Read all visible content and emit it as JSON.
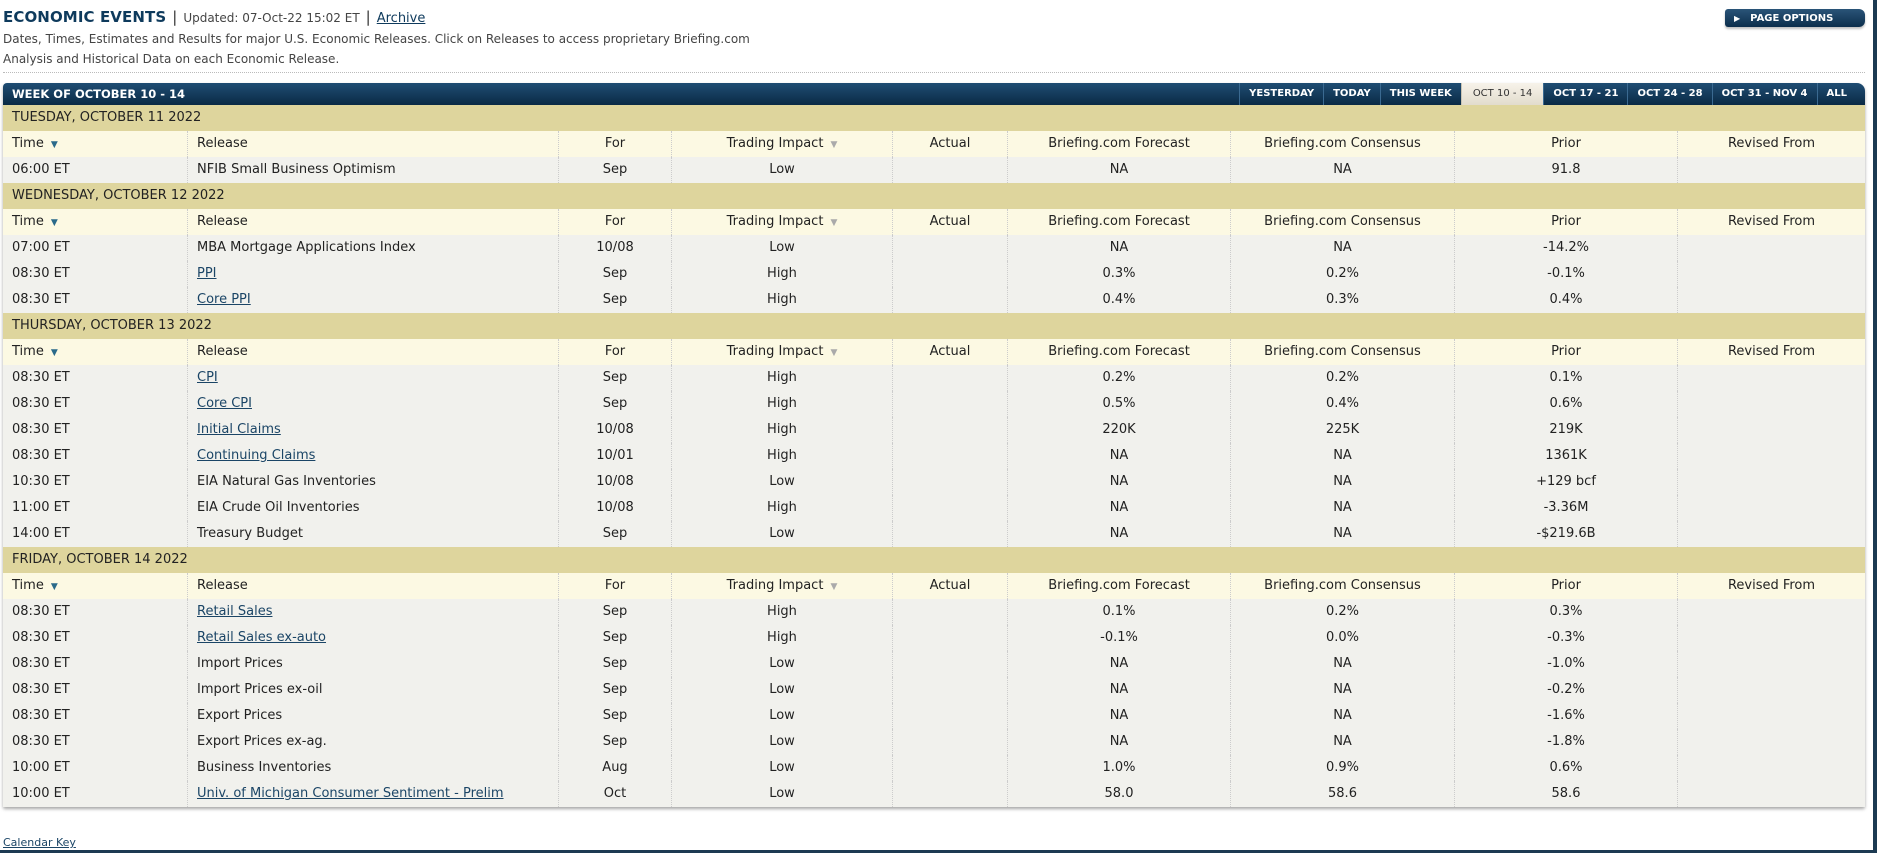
{
  "header": {
    "title": "ECONOMIC EVENTS",
    "separator": "|",
    "updated": "Updated: 07-Oct-22 15:02 ET",
    "archive_label": "Archive",
    "description": "Dates, Times, Estimates and Results for major U.S. Economic Releases. Click on Releases to access proprietary Briefing.com Analysis and Historical Data on each Economic Release."
  },
  "page_options": {
    "label": "PAGE OPTIONS",
    "icon": "play-triangle-icon"
  },
  "week_bar": {
    "title": "WEEK OF OCTOBER 10 - 14",
    "tabs": [
      {
        "label": "YESTERDAY",
        "active": false
      },
      {
        "label": "TODAY",
        "active": false
      },
      {
        "label": "THIS WEEK",
        "active": false
      },
      {
        "label": "OCT 10 - 14",
        "active": true
      },
      {
        "label": "OCT 17 - 21",
        "active": false
      },
      {
        "label": "OCT 24 - 28",
        "active": false
      },
      {
        "label": "OCT 31 - NOV 4",
        "active": false
      },
      {
        "label": "ALL",
        "active": false
      }
    ]
  },
  "columns": {
    "time": "Time",
    "release": "Release",
    "for": "For",
    "impact": "Trading Impact",
    "actual": "Actual",
    "forecast": "Briefing.com Forecast",
    "consensus": "Briefing.com Consensus",
    "prior": "Prior",
    "revised": "Revised From"
  },
  "days": [
    {
      "label": "TUESDAY, OCTOBER 11 2022",
      "rows": [
        {
          "time": "06:00 ET",
          "release": "NFIB Small Business Optimism",
          "link": false,
          "for": "Sep",
          "impact": "Low",
          "actual": "",
          "forecast": "NA",
          "consensus": "NA",
          "prior": "91.8",
          "revised": ""
        }
      ]
    },
    {
      "label": "WEDNESDAY, OCTOBER 12 2022",
      "rows": [
        {
          "time": "07:00 ET",
          "release": "MBA Mortgage Applications Index",
          "link": false,
          "for": "10/08",
          "impact": "Low",
          "actual": "",
          "forecast": "NA",
          "consensus": "NA",
          "prior": "-14.2%",
          "revised": ""
        },
        {
          "time": "08:30 ET",
          "release": "PPI",
          "link": true,
          "for": "Sep",
          "impact": "High",
          "actual": "",
          "forecast": "0.3%",
          "consensus": "0.2%",
          "prior": "-0.1%",
          "revised": ""
        },
        {
          "time": "08:30 ET",
          "release": "Core PPI",
          "link": true,
          "for": "Sep",
          "impact": "High",
          "actual": "",
          "forecast": "0.4%",
          "consensus": "0.3%",
          "prior": "0.4%",
          "revised": ""
        }
      ]
    },
    {
      "label": "THURSDAY, OCTOBER 13 2022",
      "rows": [
        {
          "time": "08:30 ET",
          "release": "CPI",
          "link": true,
          "for": "Sep",
          "impact": "High",
          "actual": "",
          "forecast": "0.2%",
          "consensus": "0.2%",
          "prior": "0.1%",
          "revised": ""
        },
        {
          "time": "08:30 ET",
          "release": "Core CPI",
          "link": true,
          "for": "Sep",
          "impact": "High",
          "actual": "",
          "forecast": "0.5%",
          "consensus": "0.4%",
          "prior": "0.6%",
          "revised": ""
        },
        {
          "time": "08:30 ET",
          "release": "Initial Claims",
          "link": true,
          "for": "10/08",
          "impact": "High",
          "actual": "",
          "forecast": "220K",
          "consensus": "225K",
          "prior": "219K",
          "revised": ""
        },
        {
          "time": "08:30 ET",
          "release": "Continuing Claims",
          "link": true,
          "for": "10/01",
          "impact": "High",
          "actual": "",
          "forecast": "NA",
          "consensus": "NA",
          "prior": "1361K",
          "revised": ""
        },
        {
          "time": "10:30 ET",
          "release": "EIA Natural Gas Inventories",
          "link": false,
          "for": "10/08",
          "impact": "Low",
          "actual": "",
          "forecast": "NA",
          "consensus": "NA",
          "prior": "+129 bcf",
          "revised": ""
        },
        {
          "time": "11:00 ET",
          "release": "EIA Crude Oil Inventories",
          "link": false,
          "for": "10/08",
          "impact": "High",
          "actual": "",
          "forecast": "NA",
          "consensus": "NA",
          "prior": "-3.36M",
          "revised": ""
        },
        {
          "time": "14:00 ET",
          "release": "Treasury Budget",
          "link": false,
          "for": "Sep",
          "impact": "Low",
          "actual": "",
          "forecast": "NA",
          "consensus": "NA",
          "prior": "-$219.6B",
          "revised": ""
        }
      ]
    },
    {
      "label": "FRIDAY, OCTOBER 14 2022",
      "rows": [
        {
          "time": "08:30 ET",
          "release": "Retail Sales",
          "link": true,
          "for": "Sep",
          "impact": "High",
          "actual": "",
          "forecast": "0.1%",
          "consensus": "0.2%",
          "prior": "0.3%",
          "revised": ""
        },
        {
          "time": "08:30 ET",
          "release": "Retail Sales ex-auto",
          "link": true,
          "for": "Sep",
          "impact": "High",
          "actual": "",
          "forecast": "-0.1%",
          "consensus": "0.0%",
          "prior": "-0.3%",
          "revised": ""
        },
        {
          "time": "08:30 ET",
          "release": "Import Prices",
          "link": false,
          "for": "Sep",
          "impact": "Low",
          "actual": "",
          "forecast": "NA",
          "consensus": "NA",
          "prior": "-1.0%",
          "revised": ""
        },
        {
          "time": "08:30 ET",
          "release": "Import Prices ex-oil",
          "link": false,
          "for": "Sep",
          "impact": "Low",
          "actual": "",
          "forecast": "NA",
          "consensus": "NA",
          "prior": "-0.2%",
          "revised": ""
        },
        {
          "time": "08:30 ET",
          "release": "Export Prices",
          "link": false,
          "for": "Sep",
          "impact": "Low",
          "actual": "",
          "forecast": "NA",
          "consensus": "NA",
          "prior": "-1.6%",
          "revised": ""
        },
        {
          "time": "08:30 ET",
          "release": "Export Prices ex-ag.",
          "link": false,
          "for": "Sep",
          "impact": "Low",
          "actual": "",
          "forecast": "NA",
          "consensus": "NA",
          "prior": "-1.8%",
          "revised": ""
        },
        {
          "time": "10:00 ET",
          "release": "Business Inventories",
          "link": false,
          "for": "Aug",
          "impact": "Low",
          "actual": "",
          "forecast": "1.0%",
          "consensus": "0.9%",
          "prior": "0.6%",
          "revised": ""
        },
        {
          "time": "10:00 ET",
          "release": "Univ. of Michigan Consumer Sentiment - Prelim",
          "link": true,
          "for": "Oct",
          "impact": "Low",
          "actual": "",
          "forecast": "58.0",
          "consensus": "58.6",
          "prior": "58.6",
          "revised": ""
        }
      ]
    }
  ],
  "footer": {
    "calendar_key_label": "Calendar Key"
  }
}
